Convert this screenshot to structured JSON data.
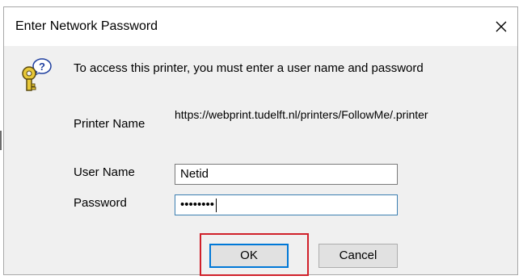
{
  "dialog": {
    "title": "Enter Network Password",
    "prompt": "To access this printer, you must enter a user name and password",
    "printer_name_label": "Printer Name",
    "printer_name_value": "https://webprint.tudelft.nl/printers/FollowMe/.printer",
    "username_label": "User Name",
    "username_value": "Netid",
    "password_label": "Password",
    "password_value": "••••••••",
    "ok_label": "OK",
    "cancel_label": "Cancel"
  },
  "icons": {
    "close": "close-icon",
    "key": "key-question-icon"
  },
  "colors": {
    "highlight": "#d0202a",
    "default_button_border": "#0078d7",
    "dialog_bg": "#f0f0f0"
  }
}
